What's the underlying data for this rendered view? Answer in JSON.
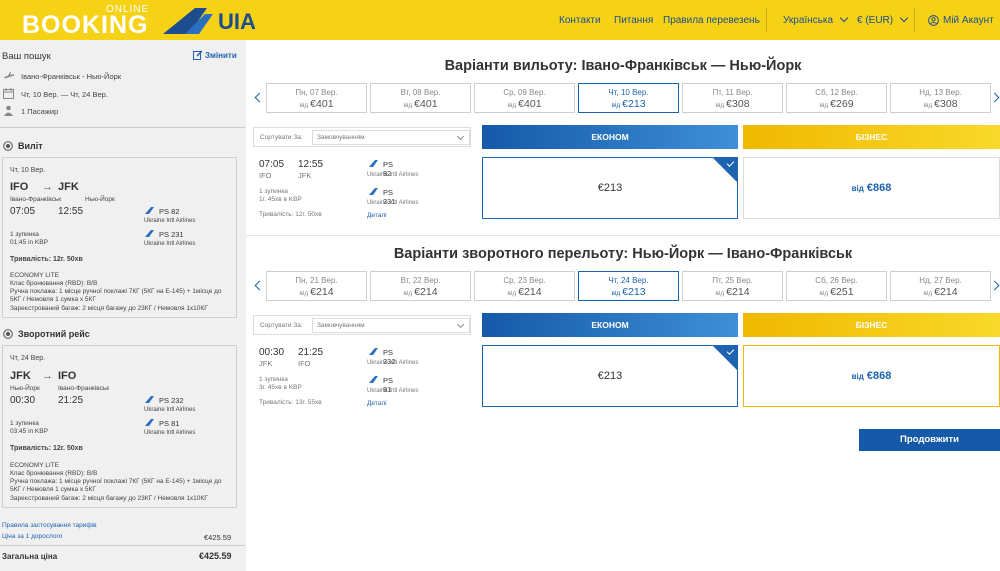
{
  "header": {
    "logo_booking": "BOOKING",
    "logo_online": "ONLINE",
    "logo_uia": "UIA",
    "nav": [
      "Контакти",
      "Питання",
      "Правила перевезень"
    ],
    "language": "Українська",
    "currency": "€ (EUR)",
    "account": "Мій Акаунт"
  },
  "sidebar": {
    "search_title": "Ваш пошук",
    "change": "Змінити",
    "route": "Івано-Франківськ - Нью-Йорк",
    "dates": "Чт, 10 Вер. — Чт, 24 Вер.",
    "passengers": "1 Пасажир",
    "outbound": {
      "heading": "Виліт",
      "date": "Чт, 10 Вер.",
      "from_code": "IFO",
      "to_code": "JFK",
      "from_city": "Івано-Франківськ",
      "to_city": "Нью-Йорк",
      "dep": "07:05",
      "arr": "12:55",
      "flights": [
        {
          "no": "PS 82",
          "airline": "Ukraine Intl Airlines"
        },
        {
          "no": "PS 231",
          "airline": "Ukraine Intl Airlines"
        }
      ],
      "stops": "1 зупинка",
      "layover": "01:45 in KBP",
      "duration": "Тривалість: 12г. 50хв",
      "fare_name": "ECONOMY LITE",
      "rbd": "Клас бронювання (RBD): B/B",
      "hand_luggage": "Ручна поклажа: 1 місце ручної поклажі 7КГ (5КГ на Е-145) + 1місце до 5КГ / Немовля 1 сумка х 5КГ",
      "checked": "Зареєстрований багаж: 2 місця багажу до 23КГ / Немовля 1х10КГ"
    },
    "inbound": {
      "heading": "Зворотний рейс",
      "date": "Чт, 24 Вер.",
      "from_code": "JFK",
      "to_code": "IFO",
      "from_city": "Нью-Йорк",
      "to_city": "Івано-Франківськ",
      "dep": "00:30",
      "arr": "21:25",
      "flights": [
        {
          "no": "PS 232",
          "airline": "Ukraine Intl Airlines"
        },
        {
          "no": "PS 81",
          "airline": "Ukraine Intl Airlines"
        }
      ],
      "stops": "1 зупинка",
      "layover": "03:45 in KBP",
      "duration": "Тривалість: 12г. 50хв",
      "fare_name": "ECONOMY LITE",
      "rbd": "Клас бронювання (RBD): B/B",
      "hand_luggage": "Ручна поклажа: 1 місце ручної поклажі 7КГ (5КГ на Е-145) + 1місце до 5КГ / Немовля 1 сумка х 5КГ",
      "checked": "Зареєстрований багаж: 2 місця багажу до 23КГ / Немовля 1х10КГ"
    },
    "tariff_rules": "Правила застосування тарифів",
    "price_adult_label": "Ціна за 1 дорослого",
    "price_adult": "€425.59",
    "total_label": "Загальна ціна",
    "total": "€425.59"
  },
  "outbound_section": {
    "title": "Варіанти вильоту: Івано-Франківськ — Нью-Йорк",
    "dates": [
      {
        "day": "Пн, 07 Вер.",
        "from": "від",
        "price": "€401",
        "selected": false
      },
      {
        "day": "Вт, 08 Вер.",
        "from": "від",
        "price": "€401",
        "selected": false
      },
      {
        "day": "Ср, 09 Вер.",
        "from": "від",
        "price": "€401",
        "selected": false
      },
      {
        "day": "Чт, 10 Вер.",
        "from": "від",
        "price": "€213",
        "selected": true
      },
      {
        "day": "Пт, 11 Вер.",
        "from": "від",
        "price": "€308",
        "selected": false
      },
      {
        "day": "Сб, 12 Вер.",
        "from": "від",
        "price": "€269",
        "selected": false
      },
      {
        "day": "Нд, 13 Вер.",
        "from": "від",
        "price": "€308",
        "selected": false
      }
    ],
    "sort_label": "Сортувати За:",
    "sort_value": "Замовчуванням",
    "economy": "ЕКОНОМ",
    "business": "БІЗНЕС",
    "flight": {
      "dep": "07:05",
      "arr": "12:55",
      "from": "IFO",
      "to": "JFK",
      "stops": "1 зупинка",
      "layover": "1г. 45хв в KBP",
      "duration": "Тривалість: 12г. 50хв",
      "legs": [
        {
          "no": "PS 82",
          "airline": "Ukraine Intl Airlines"
        },
        {
          "no": "PS 231",
          "airline": "Ukraine Intl Airlines"
        }
      ],
      "details": "Деталі",
      "econ_price": "€213",
      "bus_from": "від",
      "bus_price": "€868"
    }
  },
  "return_section": {
    "title": "Варіанти зворотного перельоту: Нью-Йорк — Івано-Франківськ",
    "dates": [
      {
        "day": "Пн, 21 Вер.",
        "from": "від",
        "price": "€214",
        "selected": false
      },
      {
        "day": "Вт, 22 Вер.",
        "from": "від",
        "price": "€214",
        "selected": false
      },
      {
        "day": "Ср, 23 Вер.",
        "from": "від",
        "price": "€214",
        "selected": false
      },
      {
        "day": "Чт, 24 Вер.",
        "from": "від",
        "price": "€213",
        "selected": true
      },
      {
        "day": "Пт, 25 Вер.",
        "from": "від",
        "price": "€214",
        "selected": false
      },
      {
        "day": "Сб, 26 Вер.",
        "from": "від",
        "price": "€251",
        "selected": false
      },
      {
        "day": "Нд, 27 Вер.",
        "from": "від",
        "price": "€214",
        "selected": false
      }
    ],
    "sort_label": "Сортувати За:",
    "sort_value": "Замовчуванням",
    "economy": "ЕКОНОМ",
    "business": "БІЗНЕС",
    "flight": {
      "dep": "00:30",
      "arr": "21:25",
      "from": "JFK",
      "to": "IFO",
      "stops": "1 зупинка",
      "layover": "3г. 45хв в KBP",
      "duration": "Тривалість: 13г. 55хв",
      "legs": [
        {
          "no": "PS 232",
          "airline": "Ukraine Intl Airlines"
        },
        {
          "no": "PS 81",
          "airline": "Ukraine Intl Airlines"
        }
      ],
      "details": "Деталі",
      "econ_price": "€213",
      "bus_from": "від",
      "bus_price": "€868"
    }
  },
  "continue_button": "Продовжити"
}
